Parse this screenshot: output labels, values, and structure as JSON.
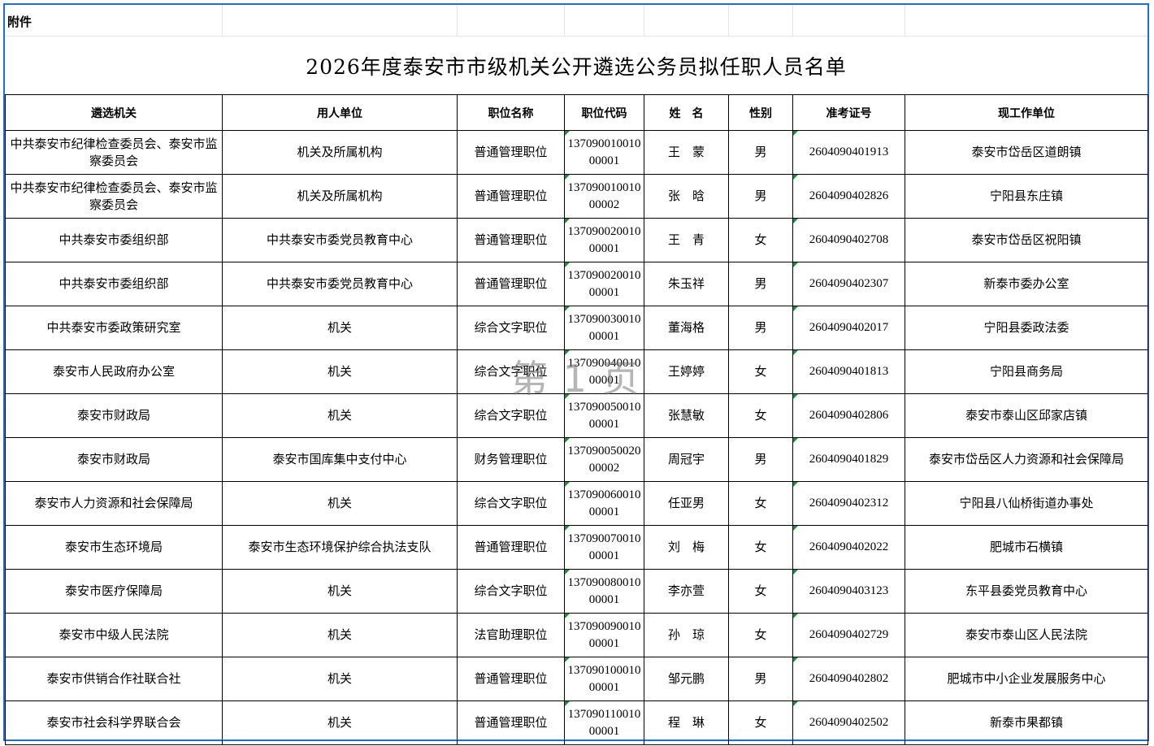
{
  "attachment_label": "附件",
  "title": "2026年度泰安市市级机关公开遴选公务员拟任职人员名单",
  "headers": [
    "遴选机关",
    "用人单位",
    "职位名称",
    "职位代码",
    "姓　名",
    "性别",
    "准考证号",
    "现工作单位"
  ],
  "rows": [
    [
      "中共泰安市纪律检查委员会、泰安市监察委员会",
      "机关及所属机构",
      "普通管理职位",
      "13709001001000001",
      "王　蒙",
      "男",
      "2604090401913",
      "泰安市岱岳区道朗镇"
    ],
    [
      "中共泰安市纪律检查委员会、泰安市监察委员会",
      "机关及所属机构",
      "普通管理职位",
      "13709001001000002",
      "张　晗",
      "男",
      "2604090402826",
      "宁阳县东庄镇"
    ],
    [
      "中共泰安市委组织部",
      "中共泰安市委党员教育中心",
      "普通管理职位",
      "13709002001000001",
      "王　青",
      "女",
      "2604090402708",
      "泰安市岱岳区祝阳镇"
    ],
    [
      "中共泰安市委组织部",
      "中共泰安市委党员教育中心",
      "普通管理职位",
      "13709002001000001",
      "朱玉祥",
      "男",
      "2604090402307",
      "新泰市委办公室"
    ],
    [
      "中共泰安市委政策研究室",
      "机关",
      "综合文字职位",
      "13709003001000001",
      "董海格",
      "男",
      "2604090402017",
      "宁阳县委政法委"
    ],
    [
      "泰安市人民政府办公室",
      "机关",
      "综合文字职位",
      "13709004001000001",
      "王婷婷",
      "女",
      "2604090401813",
      "宁阳县商务局"
    ],
    [
      "泰安市财政局",
      "机关",
      "综合文字职位",
      "13709005001000001",
      "张慧敏",
      "女",
      "2604090402806",
      "泰安市泰山区邱家店镇"
    ],
    [
      "泰安市财政局",
      "泰安市国库集中支付中心",
      "财务管理职位",
      "13709005002000002",
      "周冠宇",
      "男",
      "2604090401829",
      "泰安市岱岳区人力资源和社会保障局"
    ],
    [
      "泰安市人力资源和社会保障局",
      "机关",
      "综合文字职位",
      "13709006001000001",
      "任亚男",
      "女",
      "2604090402312",
      "宁阳县八仙桥街道办事处"
    ],
    [
      "泰安市生态环境局",
      "泰安市生态环境保护综合执法支队",
      "普通管理职位",
      "13709007001000001",
      "刘　梅",
      "女",
      "2604090402022",
      "肥城市石横镇"
    ],
    [
      "泰安市医疗保障局",
      "机关",
      "综合文字职位",
      "13709008001000001",
      "李亦萱",
      "女",
      "2604090403123",
      "东平县委党员教育中心"
    ],
    [
      "泰安市中级人民法院",
      "机关",
      "法官助理职位",
      "13709009001000001",
      "孙　琼",
      "女",
      "2604090402729",
      "泰安市泰山区人民法院"
    ],
    [
      "泰安市供销合作社联合社",
      "机关",
      "普通管理职位",
      "13709010001000001",
      "邹元鹏",
      "男",
      "2604090402802",
      "肥城市中小企业发展服务中心"
    ],
    [
      "泰安市社会科学界联合会",
      "机关",
      "普通管理职位",
      "13709011001000001",
      "程　琳",
      "女",
      "2604090402502",
      "新泰市果都镇"
    ]
  ],
  "watermark": "第 1 页",
  "colors": {
    "frame_border": "#1f6fd0",
    "cell_marker": "#1e8a3c",
    "watermark": "#787878"
  }
}
